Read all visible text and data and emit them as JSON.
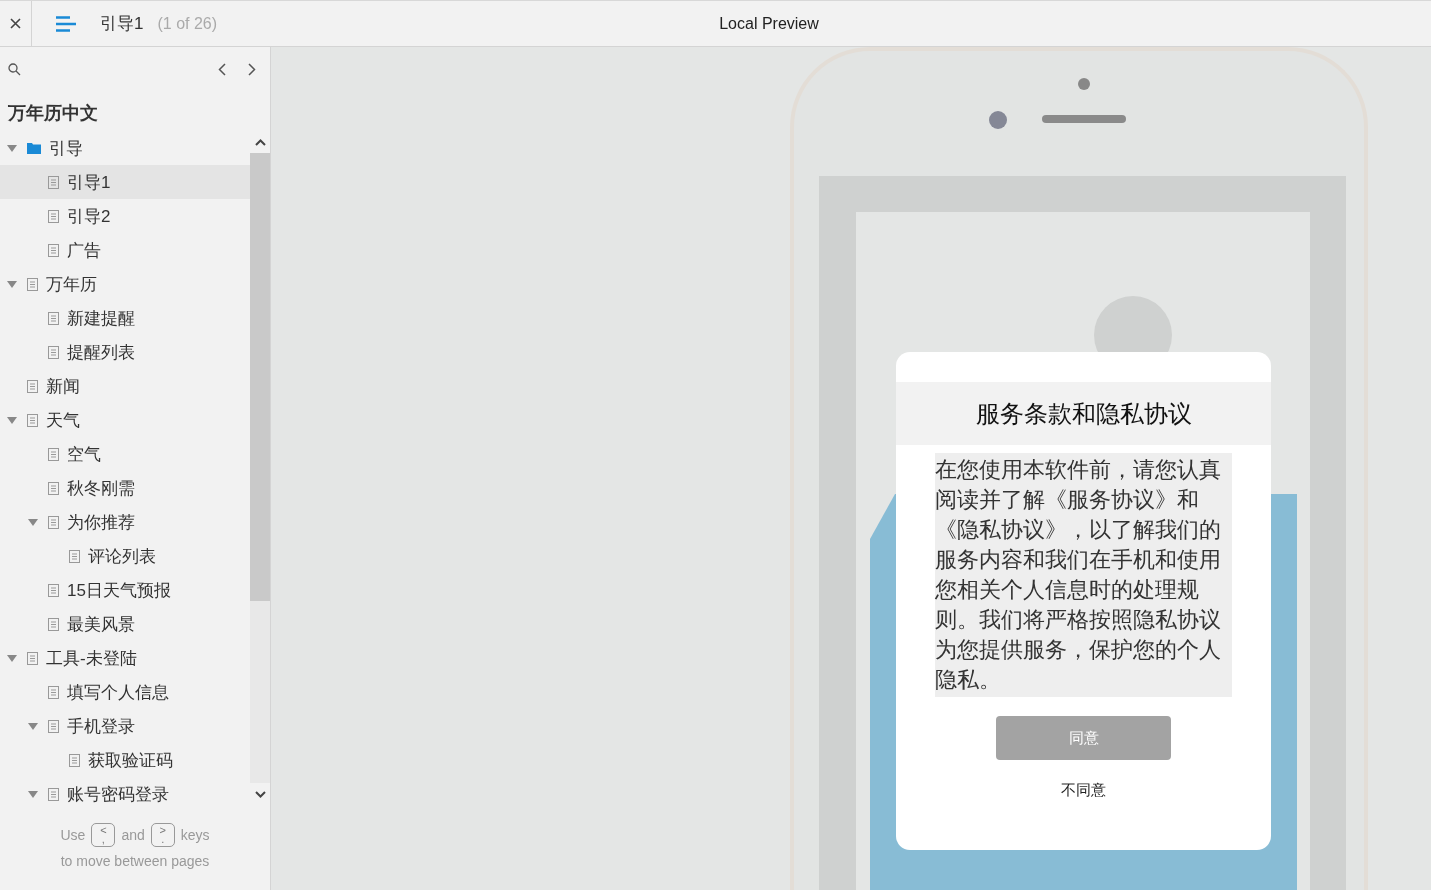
{
  "topbar": {
    "page_title": "引导1",
    "page_count": "(1 of 26)",
    "preview_title": "Local Preview"
  },
  "sidebar": {
    "project_title": "万年历中文",
    "tree": [
      {
        "label": "引导",
        "kind": "folder",
        "expanded": true,
        "selected": false,
        "children": [
          {
            "label": "引导1",
            "kind": "page",
            "selected": true
          },
          {
            "label": "引导2",
            "kind": "page",
            "selected": false
          },
          {
            "label": "广告",
            "kind": "page",
            "selected": false
          }
        ]
      },
      {
        "label": "万年历",
        "kind": "page",
        "expanded": true,
        "selected": false,
        "children": [
          {
            "label": "新建提醒",
            "kind": "page",
            "selected": false
          },
          {
            "label": "提醒列表",
            "kind": "page",
            "selected": false
          }
        ]
      },
      {
        "label": "新闻",
        "kind": "page",
        "selected": false
      },
      {
        "label": "天气",
        "kind": "page",
        "expanded": true,
        "selected": false,
        "children": [
          {
            "label": "空气",
            "kind": "page",
            "selected": false
          },
          {
            "label": "秋冬刚需",
            "kind": "page",
            "selected": false
          },
          {
            "label": "为你推荐",
            "kind": "page",
            "expanded": true,
            "selected": false,
            "children": [
              {
                "label": "评论列表",
                "kind": "page",
                "selected": false
              }
            ]
          },
          {
            "label": "15日天气预报",
            "kind": "page",
            "selected": false
          },
          {
            "label": "最美风景",
            "kind": "page",
            "selected": false
          }
        ]
      },
      {
        "label": "工具-未登陆",
        "kind": "page",
        "expanded": true,
        "selected": false,
        "children": [
          {
            "label": "填写个人信息",
            "kind": "page",
            "selected": false
          },
          {
            "label": "手机登录",
            "kind": "page",
            "expanded": true,
            "selected": false,
            "children": [
              {
                "label": "获取验证码",
                "kind": "page",
                "selected": false
              }
            ]
          },
          {
            "label": "账号密码登录",
            "kind": "page",
            "expanded": true,
            "selected": false
          }
        ]
      }
    ],
    "hint": {
      "use": "Use",
      "key_prev_top": "<",
      "key_prev_bottom": ",",
      "and": "and",
      "key_next_top": ">",
      "key_next_bottom": ".",
      "keys": "keys",
      "line2": "to move between pages"
    }
  },
  "dialog": {
    "title": "服务条款和隐私协议",
    "body": "在您使用本软件前，请您认真阅读并了解《服务协议》和《隐私协议》，以了解我们的服务内容和我们在手机和使用您相关个人信息时的处理规则。我们将严格按照隐私协议为您提供服务，保护您的个人隐私。",
    "agree": "同意",
    "disagree": "不同意"
  }
}
